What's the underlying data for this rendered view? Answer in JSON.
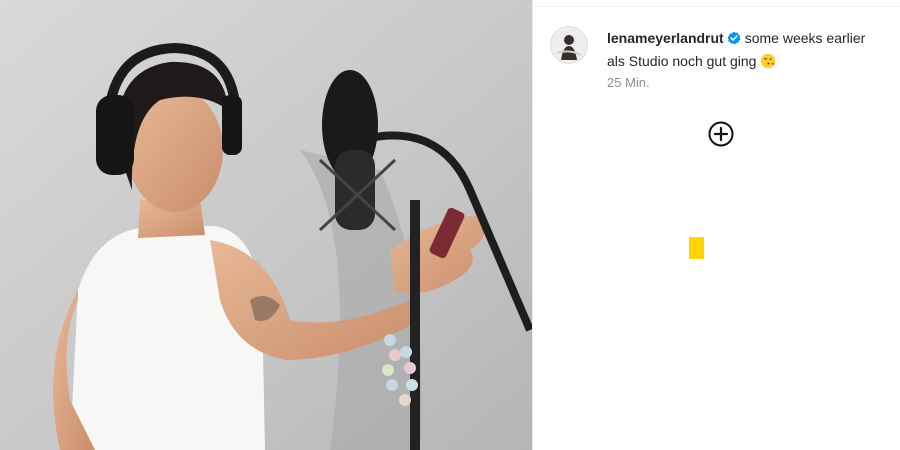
{
  "photo": {
    "alt_subject": "woman in studio with headphones and microphone"
  },
  "post": {
    "username": "lenameyerlandrut",
    "verified": true,
    "caption": "some weeks earlier als Studio noch gut ging",
    "caption_emoji": "face-blowing-kiss",
    "time_ago": "25 Min."
  },
  "actions": {
    "add_icon": "plus-circle-icon"
  },
  "colors": {
    "verified_blue": "#0095f6",
    "marker_yellow": "#ffd400",
    "text_primary": "#262626",
    "text_secondary": "#8e8e8e"
  }
}
